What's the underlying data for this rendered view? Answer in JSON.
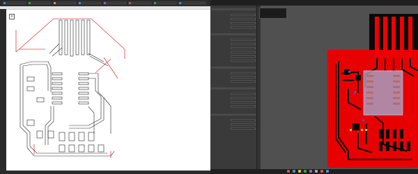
{
  "left_window": {
    "tabs": [
      {
        "label": "",
        "color": "#4a90d9"
      },
      {
        "label": "",
        "color": "#3fa34d"
      },
      {
        "label": "",
        "color": "#e8a33d"
      },
      {
        "label": "",
        "color": "#4a90d9"
      },
      {
        "label": "",
        "color": "#8e6cc5"
      },
      {
        "label": "",
        "color": "#d9534f"
      },
      {
        "label": "",
        "color": "#3fa34d"
      },
      {
        "label": "",
        "color": "#4a90d9"
      }
    ],
    "close_glyph": "×",
    "trace_color_red": "#e04040",
    "trace_color_dark": "#222222"
  },
  "right_window": {
    "title": "",
    "popup_items": [
      "",
      "",
      ""
    ],
    "panel_sections": [
      "",
      "",
      "",
      "",
      ""
    ],
    "status": "",
    "colors": {
      "copper": "#f00000",
      "board": "#e80000",
      "trace": "#0a0a0a",
      "overlay": "#9fb3d9",
      "background": "#505050",
      "pad_yellow": "#e6c21a"
    }
  }
}
